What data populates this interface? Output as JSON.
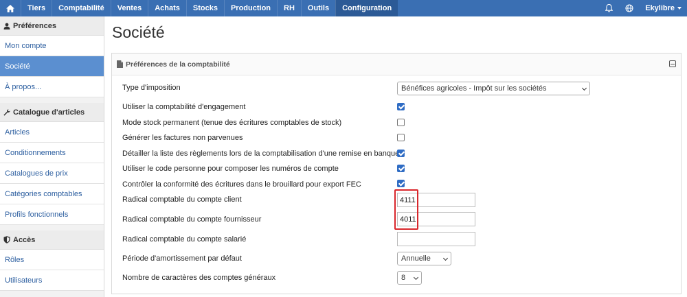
{
  "nav": {
    "items": [
      "Tiers",
      "Comptabilité",
      "Ventes",
      "Achats",
      "Stocks",
      "Production",
      "RH",
      "Outils",
      "Configuration"
    ],
    "active": "Configuration",
    "user": "Ekylibre"
  },
  "sidebar": {
    "sections": [
      {
        "title": "Préférences",
        "icon": "user-icon",
        "items": [
          "Mon compte",
          "Société",
          "À propos..."
        ]
      },
      {
        "title": "Catalogue d'articles",
        "icon": "wrench-icon",
        "items": [
          "Articles",
          "Conditionnements",
          "Catalogues de prix",
          "Catégories comptables",
          "Profils fonctionnels"
        ]
      },
      {
        "title": "Accès",
        "icon": "shield-icon",
        "items": [
          "Rôles",
          "Utilisateurs"
        ]
      }
    ],
    "active_item": "Société"
  },
  "page": {
    "title": "Société"
  },
  "panel": {
    "title": "Préférences de la comptabilité",
    "rows": {
      "imposition_label": "Type d'imposition",
      "imposition_value": "Bénéfices agricoles - Impôt sur les sociétés",
      "engagement_label": "Utiliser la comptabilité d'engagement",
      "engagement_checked": true,
      "stock_label": "Mode stock permanent (tenue des écritures comptables de stock)",
      "stock_checked": false,
      "factures_label": "Générer les factures non parvenues",
      "factures_checked": false,
      "reglements_label": "Détailler la liste des règlements lors de la comptabilisation d'une remise en banque",
      "reglements_checked": true,
      "code_label": "Utiliser le code personne pour composer les numéros de compte",
      "code_checked": true,
      "fec_label": "Contrôler la conformité des écritures dans le brouillard pour export FEC",
      "fec_checked": true,
      "client_label": "Radical comptable du compte client",
      "client_value": "4111",
      "fournisseur_label": "Radical comptable du compte fournisseur",
      "fournisseur_value": "4011",
      "salarie_label": "Radical comptable du compte salarié",
      "salarie_value": "",
      "amort_label": "Période d'amortissement par défaut",
      "amort_value": "Annuelle",
      "chars_label": "Nombre de caractères des comptes généraux",
      "chars_value": "8"
    }
  },
  "colors": {
    "nav_bg": "#3a6fb3",
    "active_item": "#5b8fd0",
    "link": "#2d5fa0",
    "highlight": "#d9262b"
  }
}
